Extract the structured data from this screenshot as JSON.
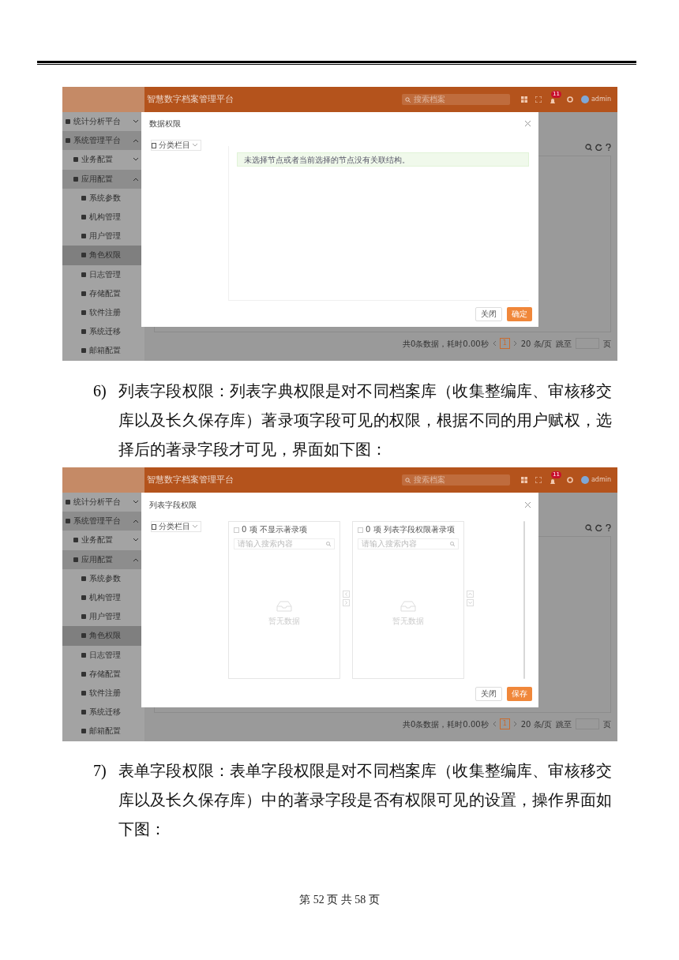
{
  "blocks": [
    {
      "kind": "screenshot",
      "header": {
        "title": "智慧数字档案管理平台",
        "search_placeholder": "搜索档案",
        "badge": "11",
        "user": "admin"
      },
      "sidebar": [
        {
          "label": "统计分析平台",
          "expanded": false,
          "selected": false
        },
        {
          "label": "系统管理平台",
          "expanded": true,
          "selected": false,
          "children": [
            {
              "label": "业务配置",
              "expanded": false,
              "selected": false
            },
            {
              "label": "应用配置",
              "expanded": true,
              "selected": false,
              "children": [
                {
                  "label": "系统参数",
                  "selected": false
                },
                {
                  "label": "机构管理",
                  "selected": false
                },
                {
                  "label": "用户管理",
                  "selected": false
                },
                {
                  "label": "角色权限",
                  "selected": true
                },
                {
                  "label": "日志管理",
                  "selected": false
                },
                {
                  "label": "存储配置",
                  "selected": false
                },
                {
                  "label": "软件注册",
                  "selected": false
                },
                {
                  "label": "系统迁移",
                  "selected": false
                },
                {
                  "label": "邮箱配置",
                  "selected": false
                }
              ]
            }
          ]
        }
      ],
      "pagination": {
        "summary": "共0条数据，耗时0.00秒",
        "page": "1",
        "page_size": "20 条/页",
        "jump_label": "跳至",
        "page_unit": "页"
      },
      "dialog": {
        "kind": "message",
        "title": "数据权限",
        "select": "分类栏目",
        "message": "未选择节点或者当前选择的节点没有关联结构。",
        "buttons": [
          {
            "label": "关闭",
            "primary": false
          },
          {
            "label": "确定",
            "primary": true
          }
        ]
      }
    },
    {
      "kind": "paragraph",
      "number": "6)",
      "text": "列表字段权限：列表字典权限是对不同档案库（收集整编库、审核移交库以及长久保存库）著录项字段可见的权限，根据不同的用户赋权，选择后的著录字段才可见，界面如下图："
    },
    {
      "kind": "screenshot",
      "header": {
        "title": "智慧数字档案管理平台",
        "search_placeholder": "搜索档案",
        "badge": "11",
        "user": "admin"
      },
      "sidebar": [
        {
          "label": "统计分析平台",
          "expanded": false,
          "selected": false
        },
        {
          "label": "系统管理平台",
          "expanded": true,
          "selected": false,
          "children": [
            {
              "label": "业务配置",
              "expanded": false,
              "selected": false
            },
            {
              "label": "应用配置",
              "expanded": true,
              "selected": false,
              "children": [
                {
                  "label": "系统参数",
                  "selected": false
                },
                {
                  "label": "机构管理",
                  "selected": false
                },
                {
                  "label": "用户管理",
                  "selected": false
                },
                {
                  "label": "角色权限",
                  "selected": true
                },
                {
                  "label": "日志管理",
                  "selected": false
                },
                {
                  "label": "存储配置",
                  "selected": false
                },
                {
                  "label": "软件注册",
                  "selected": false
                },
                {
                  "label": "系统迁移",
                  "selected": false
                },
                {
                  "label": "邮箱配置",
                  "selected": false
                }
              ]
            }
          ]
        }
      ],
      "pagination": {
        "summary": "共0条数据，耗时0.00秒",
        "page": "1",
        "page_size": "20 条/页",
        "jump_label": "跳至",
        "page_unit": "页"
      },
      "dialog": {
        "kind": "transfer",
        "title": "列表字段权限",
        "select": "分类栏目",
        "panels": [
          {
            "count": "0 项",
            "checked": false,
            "title": "不显示著录项",
            "placeholder": "请输入搜索内容",
            "empty": "暂无数据"
          },
          {
            "count": "0 项",
            "checked": false,
            "title": "列表字段权限著录项",
            "placeholder": "请输入搜索内容",
            "empty": "暂无数据"
          }
        ],
        "buttons": [
          {
            "label": "关闭",
            "primary": false
          },
          {
            "label": "保存",
            "primary": true
          }
        ]
      }
    },
    {
      "kind": "paragraph",
      "number": "7)",
      "text": "表单字段权限：表单字段权限是对不同档案库（收集整编库、审核移交库以及长久保存库）中的著录字段是否有权限可见的设置，操作界面如下图："
    }
  ],
  "footer": "第 52 页 共 58 页"
}
